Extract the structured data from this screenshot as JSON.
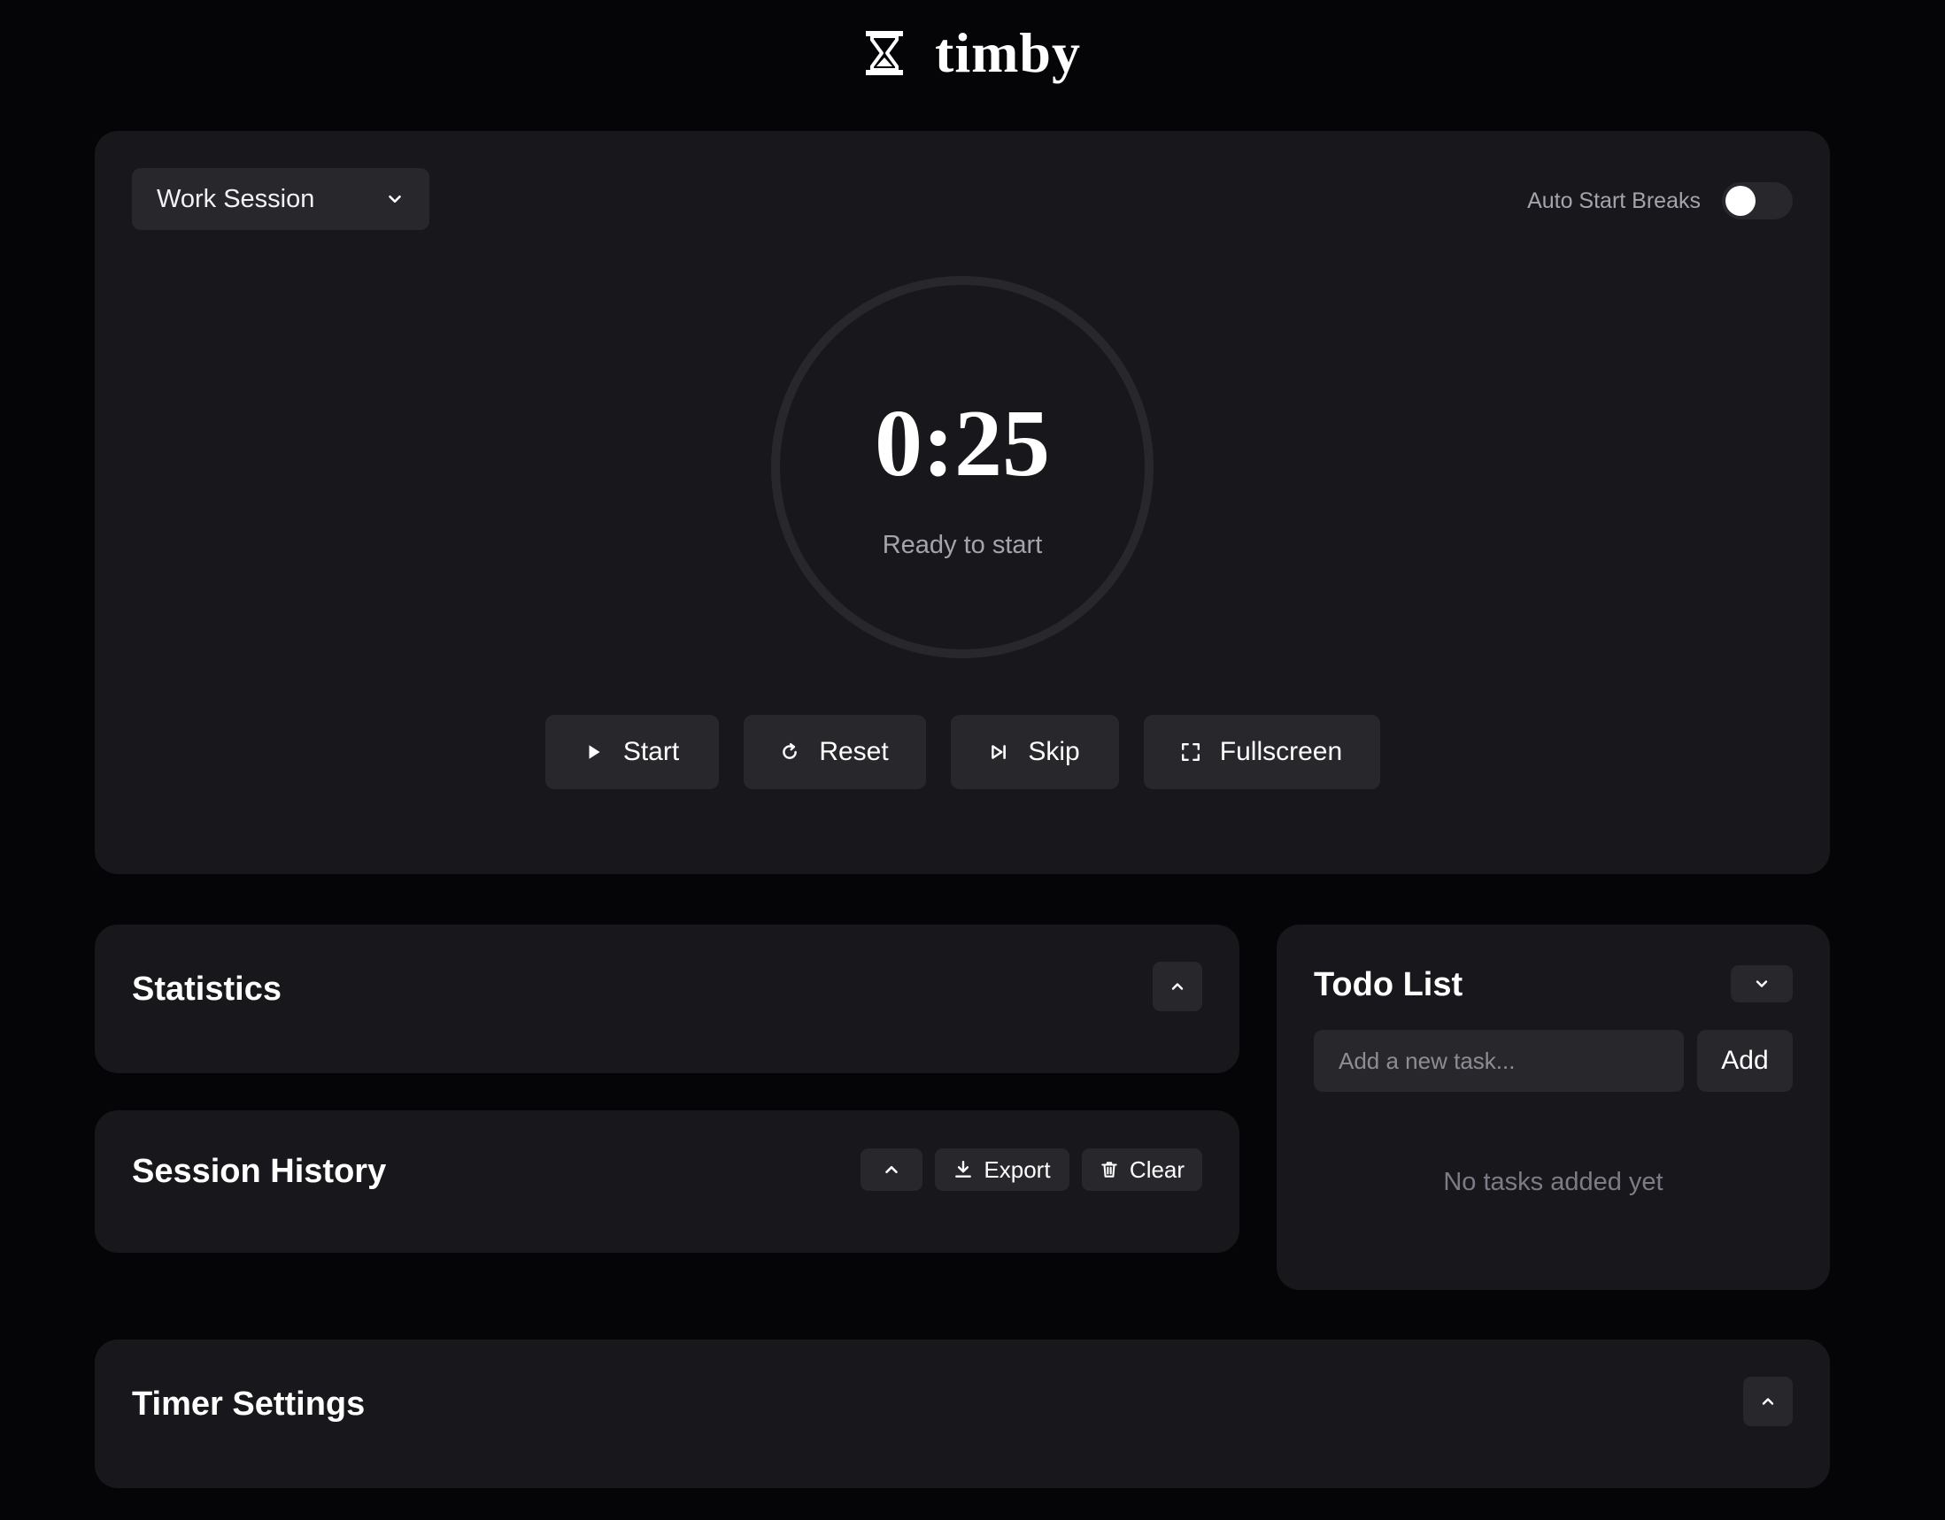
{
  "header": {
    "title": "timby",
    "icon": "hourglass-icon"
  },
  "timer": {
    "session_type": "Work Session",
    "auto_start_label": "Auto Start Breaks",
    "auto_start_enabled": false,
    "time": "0:25",
    "status": "Ready to start",
    "controls": {
      "start": "Start",
      "reset": "Reset",
      "skip": "Skip",
      "fullscreen": "Fullscreen"
    }
  },
  "statistics": {
    "title": "Statistics"
  },
  "history": {
    "title": "Session History",
    "export": "Export",
    "clear": "Clear"
  },
  "todo": {
    "title": "Todo List",
    "input_placeholder": "Add a new task...",
    "input_value": "",
    "add": "Add",
    "empty": "No tasks added yet"
  },
  "settings": {
    "title": "Timer Settings"
  },
  "colors": {
    "background": "#050507",
    "card": "#18181c",
    "control": "#27272c",
    "muted_text": "#a4a4ad",
    "ring": "#27272c"
  }
}
